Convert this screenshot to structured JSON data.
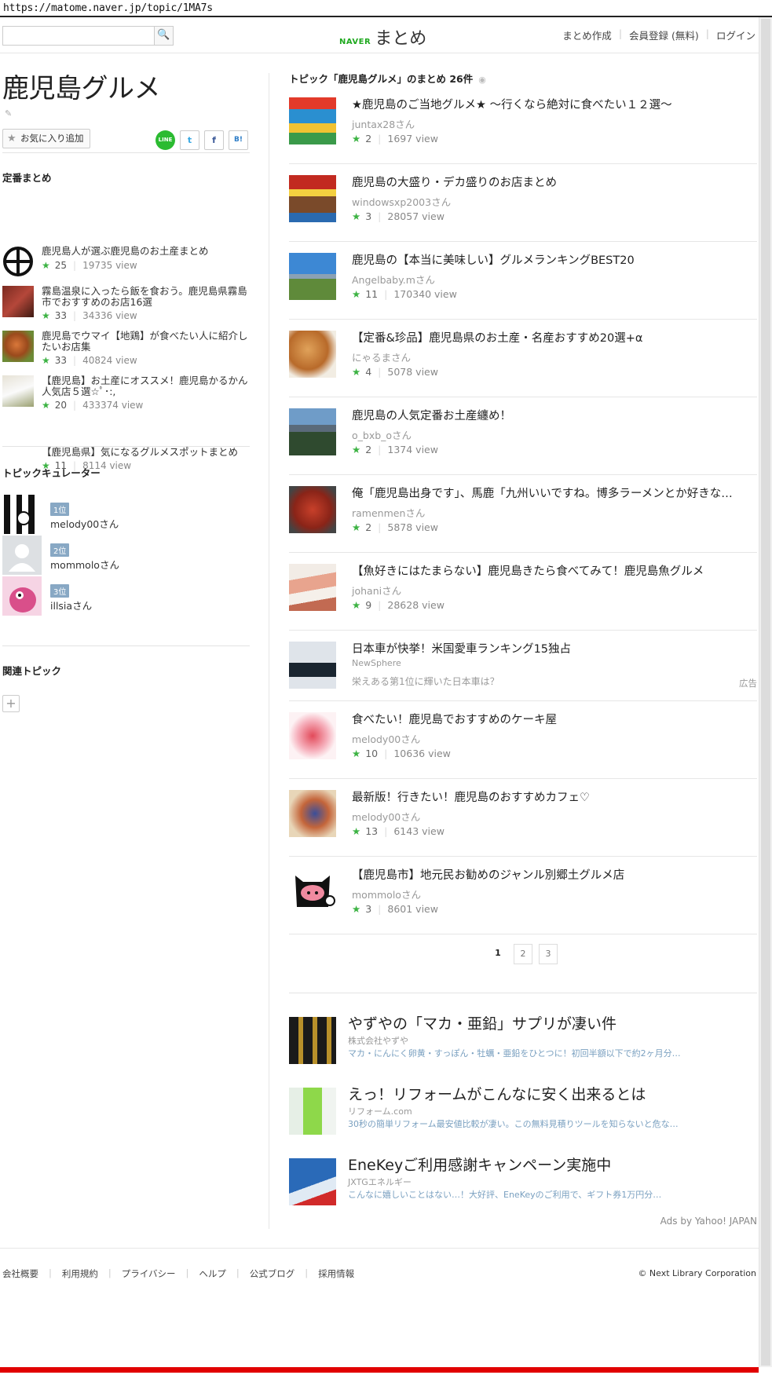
{
  "url": "https://matome.naver.jp/topic/1MA7s",
  "header": {
    "search_placeholder": "",
    "search_icon": "🔍",
    "logo_naver": "NAVER",
    "logo_matome": "まとめ",
    "nav": [
      "まとめ作成",
      "会員登録 (無料)",
      "ログイン"
    ]
  },
  "left": {
    "title": "鹿児島グルメ",
    "edit_icon": "✎",
    "fav_label": "お気に入り追加",
    "share": {
      "line": "LINE",
      "twitter": "t",
      "facebook": "f",
      "hatena": "B!"
    },
    "standard_title": "定番まとめ",
    "standard": [
      {
        "title": "鹿児島人が選ぶ鹿児島のお土産まとめ",
        "stars": "25",
        "views": "19735 view"
      },
      {
        "title": "霧島温泉に入ったら飯を食おう。鹿児島県霧島市でおすすめのお店16選",
        "stars": "33",
        "views": "34336 view"
      },
      {
        "title": "鹿児島でウマイ【地鶏】が食べたい人に紹介したいお店集",
        "stars": "33",
        "views": "40824 view"
      },
      {
        "title": "【鹿児島】お土産にオススメ！鹿児島かるかん人気店５選☆ﾟ･:,",
        "stars": "20",
        "views": "433374 view"
      },
      {
        "title": "【鹿児島県】気になるグルメスポットまとめ",
        "stars": "11",
        "views": "8114 view"
      }
    ],
    "curator_title": "トピックキュレーター",
    "curators": [
      {
        "rank": "1位",
        "name": "melody00さん"
      },
      {
        "rank": "2位",
        "name": "mommoloさん"
      },
      {
        "rank": "3位",
        "name": "illsiaさん"
      }
    ],
    "related_title": "関連トピック",
    "add_icon": "+"
  },
  "right": {
    "heading": "トピック「鹿児島グルメ」のまとめ  26件",
    "rss_icon": "◉",
    "entries": [
      {
        "title": "★鹿児島のご当地グルメ★ ～行くなら絶対に食べたい１２選～",
        "user": "juntax28さん",
        "stars": "2",
        "views": "1697 view"
      },
      {
        "title": "鹿児島の大盛り・デカ盛りのお店まとめ",
        "user": "windowsxp2003さん",
        "stars": "3",
        "views": "28057 view"
      },
      {
        "title": "鹿児島の【本当に美味しい】グルメランキングBEST20",
        "user": "Angelbaby.mさん",
        "stars": "11",
        "views": "170340 view"
      },
      {
        "title": "【定番&珍品】鹿児島県のお土産・名産おすすめ20選+α",
        "user": "にゃるまさん",
        "stars": "4",
        "views": "5078 view"
      },
      {
        "title": "鹿児島の人気定番お土産纏め！",
        "user": "o_bxb_oさん",
        "stars": "2",
        "views": "1374 view"
      },
      {
        "title": "俺「鹿児島出身です」、馬鹿「九州いいですね。博多ラーメンとか好きな…",
        "user": "ramenmenさん",
        "stars": "2",
        "views": "5878 view"
      },
      {
        "title": "【魚好きにはたまらない】鹿児島きたら食べてみて！鹿児島魚グルメ",
        "user": "johaniさん",
        "stars": "9",
        "views": "28628 view"
      }
    ],
    "ad_entry": {
      "title": "日本車が快挙！米国愛車ランキング15独占",
      "source": "NewSphere",
      "sub": "栄えある第1位に輝いた日本車は？",
      "tag": "広告"
    },
    "entries2": [
      {
        "title": "食べたい！鹿児島でおすすめのケーキ屋",
        "user": "melody00さん",
        "stars": "10",
        "views": "10636 view"
      },
      {
        "title": "最新版！行きたい！鹿児島のおすすめカフェ♡",
        "user": "melody00さん",
        "stars": "13",
        "views": "6143 view"
      },
      {
        "title": "【鹿児島市】地元民お勧めのジャンル別郷土グルメ店",
        "user": "mommoloさん",
        "stars": "3",
        "views": "8601 view"
      }
    ],
    "pages": [
      "1",
      "2",
      "3"
    ],
    "ads": [
      {
        "title": "やずやの「マカ・亜鉛」サプリが凄い件",
        "source": "株式会社やずや",
        "desc": "マカ・にんにく卵黄・すっぽん・牡蠣・亜鉛をひとつに！初回半額以下で約2ヶ月分…"
      },
      {
        "title": "えっ！リフォームがこんなに安く出来るとは",
        "source": "リフォーム.com",
        "desc": "30秒の簡単リフォーム最安値比較が凄い。この無料見積りツールを知らないと危な…"
      },
      {
        "title": "EneKeyご利用感謝キャンペーン実施中",
        "source": "JXTGエネルギー",
        "desc": "こんなに嬉しいことはない…！大好評、EneKeyのご利用で、ギフト券1万円分…"
      }
    ],
    "ads_by": "Ads by Yahoo! JAPAN"
  },
  "footer": {
    "links": [
      "会社概要",
      "利用規約",
      "プライバシー",
      "ヘルプ",
      "公式ブログ",
      "採用情報"
    ],
    "copyright": "© Next Library Corporation"
  },
  "colors": {
    "brand_green": "#1fa91f",
    "star": "#3cb343",
    "rank_badge": "#88a8c4",
    "bottom_bar": "#e10000"
  }
}
